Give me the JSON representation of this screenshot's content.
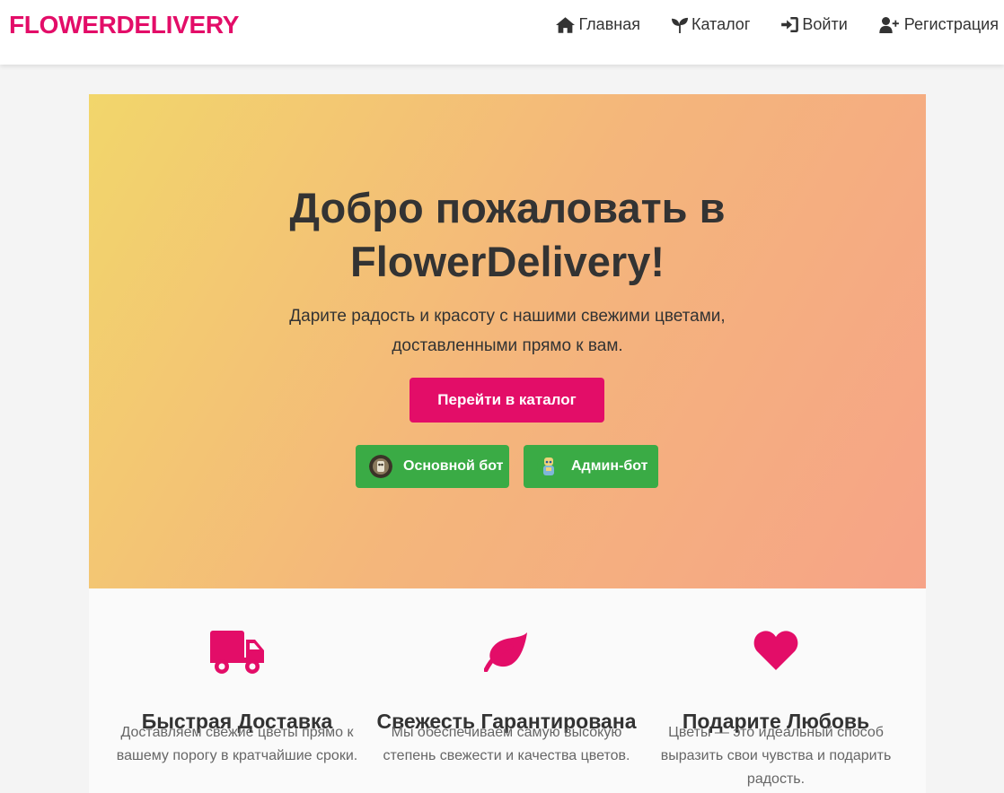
{
  "brand": "FLOWERDELIVERY",
  "nav": {
    "home": "Главная",
    "catalog": "Каталог",
    "login": "Войти",
    "register": "Регистрация"
  },
  "hero": {
    "title": "Добро пожаловать в FlowerDelivery!",
    "subtitle": "Дарите радость и красоту с нашими свежими цветами, доставленными прямо к вам.",
    "catalog_button": "Перейти в каталог",
    "main_bot_button": "Основной бот",
    "admin_bot_button": "Админ-бот"
  },
  "features": [
    {
      "icon": "truck-icon",
      "title": "Быстрая Доставка",
      "text": "Доставляем свежие цветы прямо к вашему порогу в кратчайшие сроки."
    },
    {
      "icon": "leaf-icon",
      "title": "Свежесть Гарантирована",
      "text": "Мы обеспечиваем самую высокую степень свежести и качества цветов."
    },
    {
      "icon": "heart-icon",
      "title": "Подарите Любовь",
      "text": "Цветы — это идеальный способ выразить свои чувства и подарить радость."
    }
  ],
  "colors": {
    "brand": "#e30d68",
    "bot_button": "#3aab45",
    "hero_gradient_start": "#f2d66b",
    "hero_gradient_end": "#f6a387",
    "text": "#333333",
    "muted_text": "#666666"
  }
}
